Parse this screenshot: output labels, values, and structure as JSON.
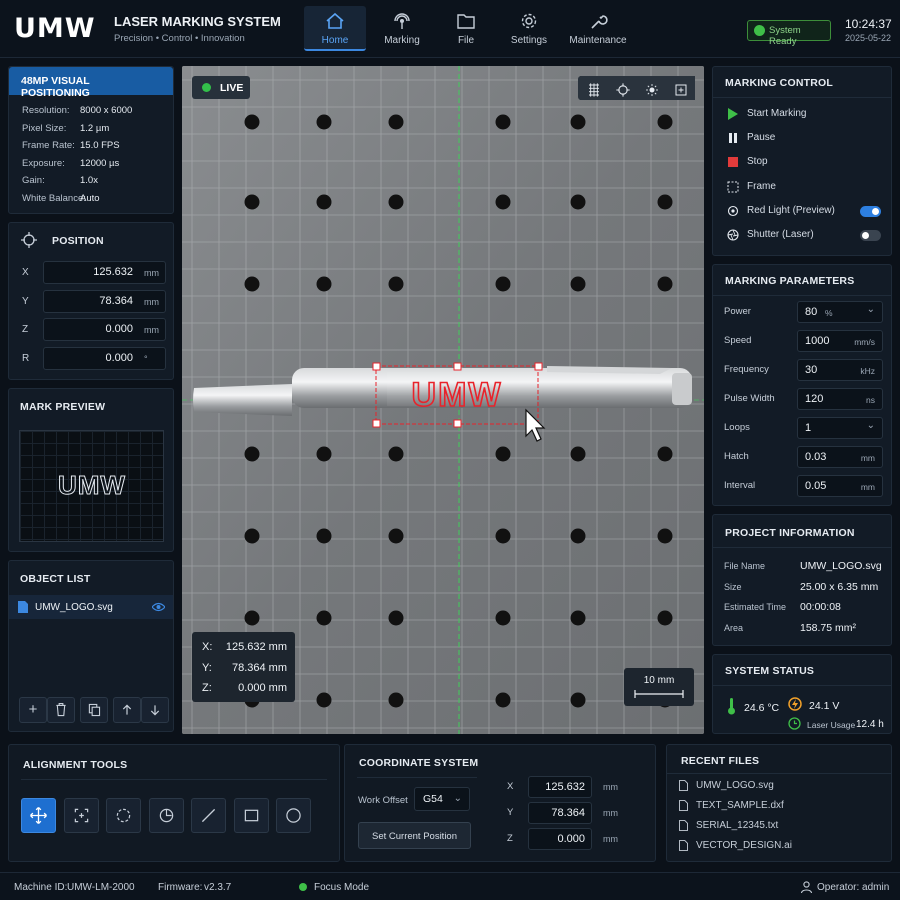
{
  "header": {
    "logo": "UMW",
    "title": "LASER MARKING SYSTEM",
    "subtitle": "Precision • Control • Innovation",
    "nav": [
      {
        "label": "Home",
        "icon": "home-icon",
        "active": true
      },
      {
        "label": "Marking",
        "icon": "marking-icon"
      },
      {
        "label": "File",
        "icon": "folder-icon"
      },
      {
        "label": "Settings",
        "icon": "gear-icon"
      },
      {
        "label": "Maintenance",
        "icon": "wrench-icon"
      }
    ],
    "status": "System Ready",
    "time": "10:24:37",
    "date": "2025-05-22"
  },
  "camera_info": {
    "title": "48MP VISUAL POSITIONING",
    "rows": [
      {
        "k": "Resolution:",
        "v": "8000 x 6000"
      },
      {
        "k": "Pixel Size:",
        "v": "1.2 µm"
      },
      {
        "k": "Frame Rate:",
        "v": "15.0 FPS"
      },
      {
        "k": "Exposure:",
        "v": "12000 µs"
      },
      {
        "k": "Gain:",
        "v": "1.0x"
      },
      {
        "k": "White Balance:",
        "v": "Auto"
      }
    ]
  },
  "position": {
    "title": "POSITION",
    "rows": [
      {
        "k": "X",
        "v": "125.632",
        "u": "mm"
      },
      {
        "k": "Y",
        "v": "78.364",
        "u": "mm"
      },
      {
        "k": "Z",
        "v": "0.000",
        "u": "mm"
      },
      {
        "k": "R",
        "v": "0.000",
        "u": "°"
      }
    ]
  },
  "mark_preview": {
    "title": "MARK PREVIEW",
    "text": "UMW"
  },
  "object_list": {
    "title": "OBJECT LIST",
    "items": [
      "UMW_LOGO.svg"
    ]
  },
  "camera": {
    "live": "LIVE",
    "mark_text": "UMW",
    "coords": [
      {
        "k": "X:",
        "v": "125.632 mm"
      },
      {
        "k": "Y:",
        "v": "78.364 mm"
      },
      {
        "k": "Z:",
        "v": "0.000 mm"
      }
    ],
    "scale": "10 mm"
  },
  "marking_control": {
    "title": "MARKING CONTROL",
    "items": [
      "Start Marking",
      "Pause",
      "Stop",
      "Frame",
      "Red Light (Preview)",
      "Shutter (Laser)"
    ],
    "red_light_on": true,
    "shutter_on": false
  },
  "marking_params": {
    "title": "MARKING PARAMETERS",
    "rows": [
      {
        "k": "Power",
        "v": "80",
        "u": "%",
        "dropdown": true
      },
      {
        "k": "Speed",
        "v": "1000",
        "u": "mm/s"
      },
      {
        "k": "Frequency",
        "v": "30",
        "u": "kHz"
      },
      {
        "k": "Pulse Width",
        "v": "120",
        "u": "ns"
      },
      {
        "k": "Loops",
        "v": "1",
        "u": "",
        "dropdown": true
      },
      {
        "k": "Hatch",
        "v": "0.03",
        "u": "mm"
      },
      {
        "k": "Interval",
        "v": "0.05",
        "u": "mm"
      }
    ]
  },
  "project": {
    "title": "PROJECT INFORMATION",
    "rows": [
      {
        "k": "File Name",
        "v": "UMW_LOGO.svg"
      },
      {
        "k": "Size",
        "v": "25.00 x 6.35 mm"
      },
      {
        "k": "Estimated Time",
        "v": "00:00:08"
      },
      {
        "k": "Area",
        "v": "158.75 mm²"
      }
    ]
  },
  "system_status": {
    "title": "SYSTEM STATUS",
    "temp": "24.6 °C",
    "voltage": "24.1 V",
    "usage_label": "Laser Usage",
    "usage": "12.4 h"
  },
  "alignment": {
    "title": "ALIGNMENT TOOLS"
  },
  "coordinate": {
    "title": "COORDINATE SYSTEM",
    "offset_label": "Work Offset",
    "offset": "G54",
    "button": "Set Current Position",
    "rows": [
      {
        "k": "X",
        "v": "125.632",
        "u": "mm"
      },
      {
        "k": "Y",
        "v": "78.364",
        "u": "mm"
      },
      {
        "k": "Z",
        "v": "0.000",
        "u": "mm"
      }
    ]
  },
  "recent": {
    "title": "RECENT FILES",
    "files": [
      "UMW_LOGO.svg",
      "TEXT_SAMPLE.dxf",
      "SERIAL_12345.txt",
      "VECTOR_DESIGN.ai"
    ]
  },
  "statusbar": {
    "machine_label": "Machine ID:",
    "machine": "UMW-LM-2000",
    "firmware_label": "Firmware:",
    "firmware": "v2.3.7",
    "focus": "Focus Mode",
    "operator": "Operator: admin"
  },
  "colors": {
    "accent": "#3c88e0",
    "ok": "#3fbf48",
    "danger": "#e23b3b",
    "mark": "#e8232b"
  }
}
